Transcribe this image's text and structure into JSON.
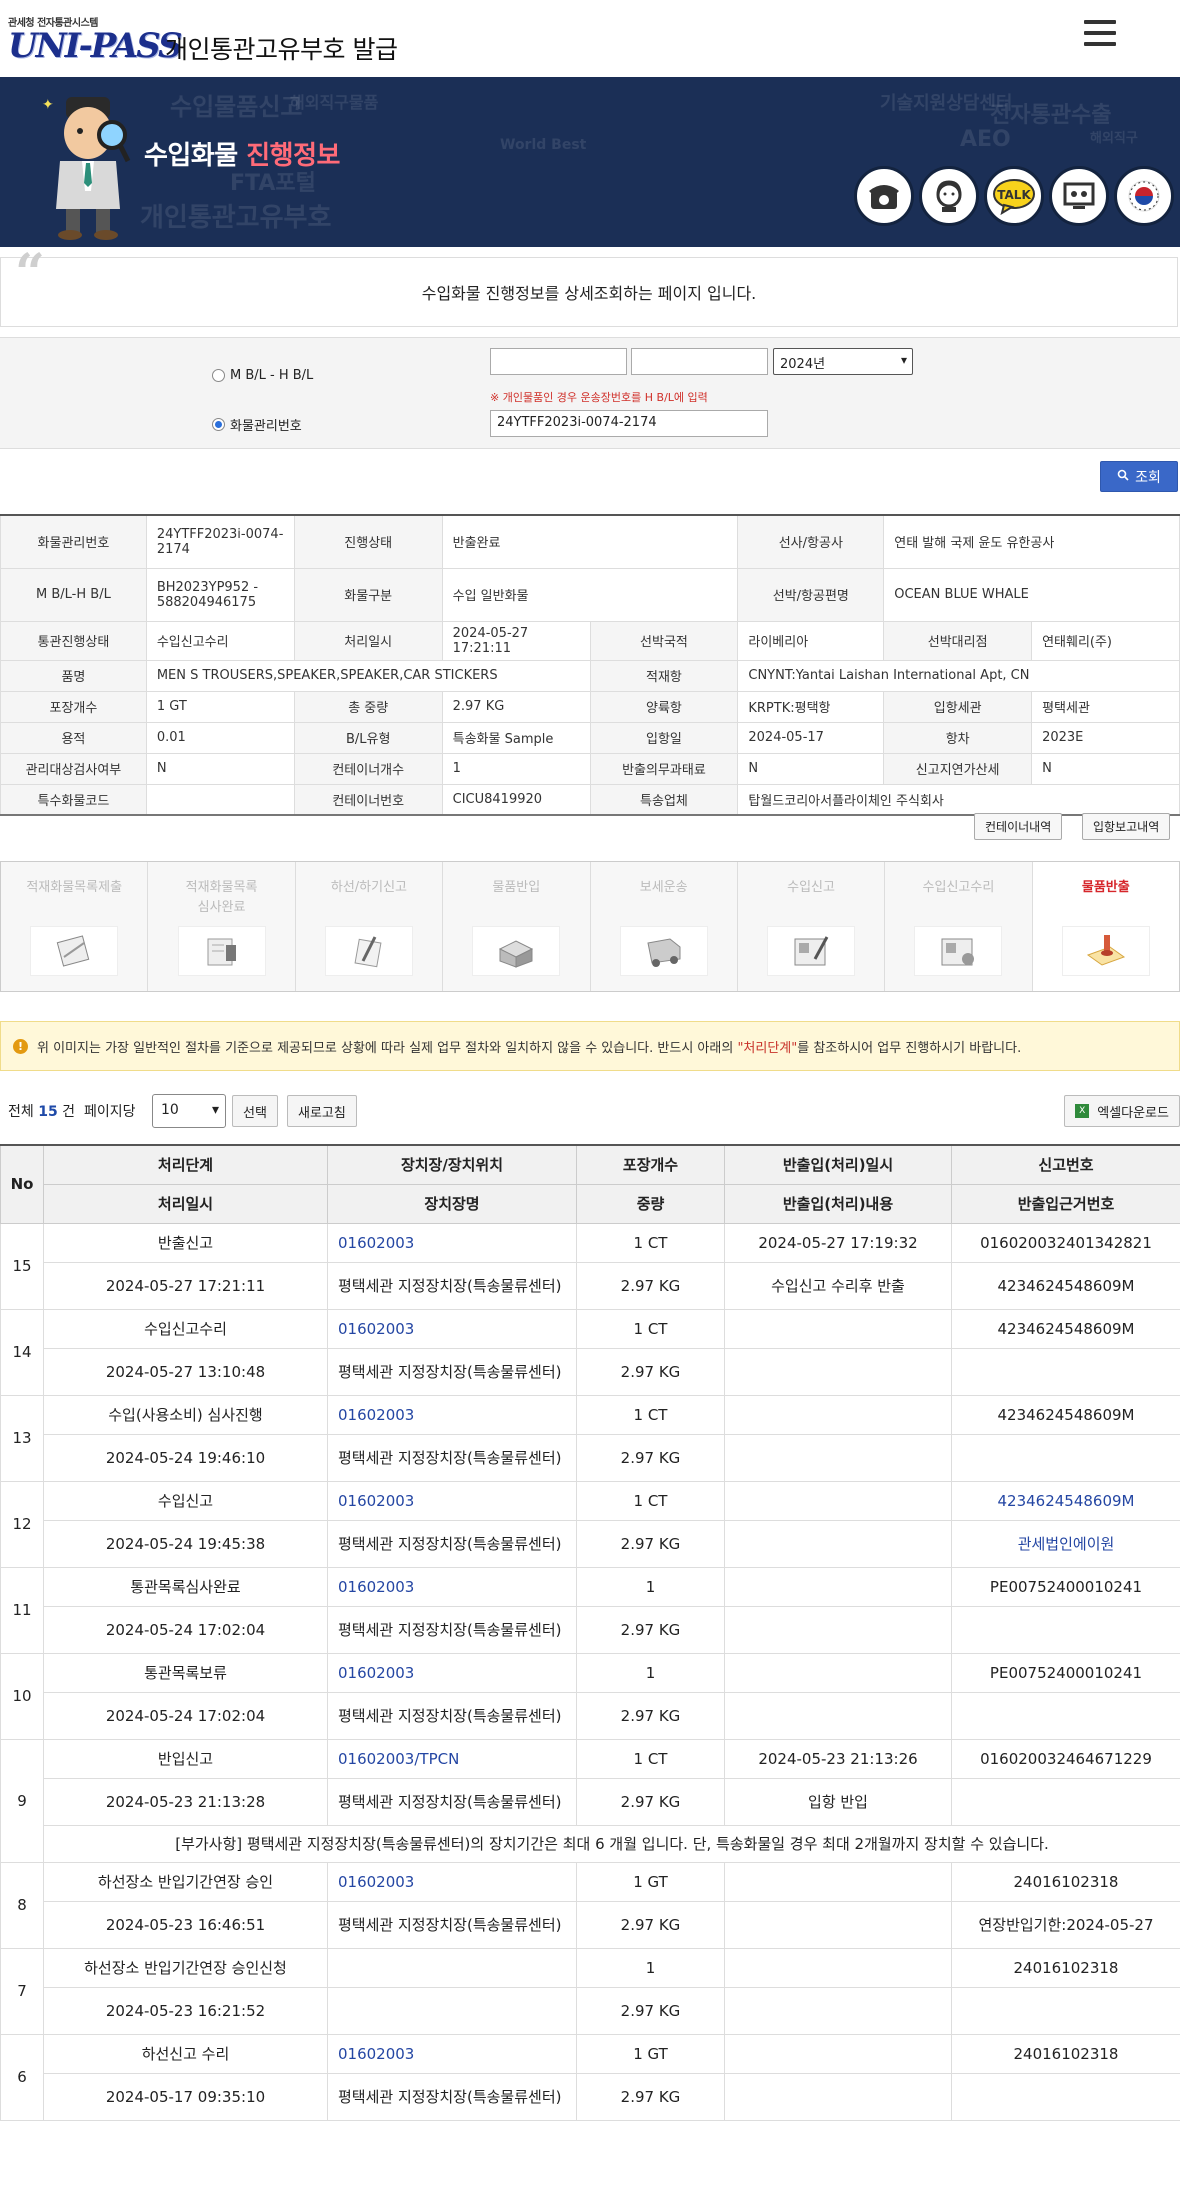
{
  "header": {
    "logo_small": "관세청 전자통관시스템",
    "logo_main": "UNI-PASS",
    "site_title": "개인통관고유부호 발급"
  },
  "banner": {
    "title_white": "수입화물",
    "title_accent": "진행정보",
    "bg_words": [
      "수입물품신고",
      "해외직구물품",
      "개인통관고유부호",
      "FTA포털",
      "World Best",
      "기술지원상담센터",
      "전자통관수출",
      "AEO",
      "해외직구"
    ]
  },
  "description": "수입화물 진행정보를 상세조회하는 페이지 입니다.",
  "search": {
    "radio_mbl": "M B/L - H B/L",
    "radio_cargo": "화물관리번호",
    "year_select": "2024년",
    "note": "※ 개인물품인 경우 운송장번호를 H B/L에 입력",
    "cargo_no": "24YTFF2023i-0074-2174",
    "query_button": "조회"
  },
  "info": {
    "rows": [
      [
        "화물관리번호",
        "24YTFF2023i-0074-2174",
        "진행상태",
        "반출완료",
        "선사/항공사",
        "연태 발해 국제 윤도 유한공사"
      ],
      [
        "M B/L-H B/L",
        "BH2023YP952 - 588204946175",
        "화물구분",
        "수입 일반화물",
        "선박/항공편명",
        "OCEAN BLUE WHALE"
      ],
      [
        "통관진행상태",
        "수입신고수리",
        "처리일시",
        "2024-05-27 17:21:11",
        "선박국적",
        "라이베리아",
        "선박대리점",
        "연태훼리(주)"
      ],
      [
        "품명",
        "MEN S TROUSERS,SPEAKER,SPEAKER,CAR STICKERS",
        "적재항",
        "CNYNT:Yantai Laishan International Apt, CN"
      ],
      [
        "포장개수",
        "1 GT",
        "총 중량",
        "2.97 KG",
        "양륙항",
        "KRPTK:평택항",
        "입항세관",
        "평택세관"
      ],
      [
        "용적",
        "0.01",
        "B/L유형",
        "특송화물 Sample",
        "입항일",
        "2024-05-17",
        "항차",
        "2023E"
      ],
      [
        "관리대상검사여부",
        "N",
        "컨테이너개수",
        "1",
        "반출의무과태료",
        "N",
        "신고지연가산세",
        "N"
      ],
      [
        "특수화물코드",
        "",
        "컨테이너번호",
        "CICU8419920",
        "특송업체",
        "탑월드코리아서플라이체인 주식회사"
      ]
    ],
    "btn_container": "컨테이너내역",
    "btn_entry_report": "입항보고내역"
  },
  "steps": [
    "적재화물목록제출",
    "적재화물목록\n심사완료",
    "하선/하기신고",
    "물품반입",
    "보세운송",
    "수입신고",
    "수입신고수리",
    "물품반출"
  ],
  "notice": {
    "text_before": "위 이미지는 가장 일반적인 절차를 기준으로 제공되므로 상황에 따라 실제 업무 절차와 일치하지 않을 수 있습니다. 반드시 아래의 ",
    "text_highlight": "\"처리단계\"",
    "text_after": "를 참조하시어 업무 진행하시기 바랍니다."
  },
  "list": {
    "total_prefix": "전체",
    "total_count": "15",
    "total_suffix": "건",
    "per_page_label": "페이지당",
    "per_page_value": "10",
    "btn_select": "선택",
    "btn_refresh": "새로고침",
    "btn_excel": "엑셀다운로드"
  },
  "history": {
    "headers_top": [
      "No",
      "처리단계",
      "장치장/장치위치",
      "포장개수",
      "반출입(처리)일시",
      "신고번호"
    ],
    "headers_bottom": [
      "처리일시",
      "장치장명",
      "중량",
      "반출입(처리)내용",
      "반출입근거번호"
    ],
    "rows": [
      {
        "no": "15",
        "stage": "반출신고",
        "loc": "01602003",
        "pkg": "1 CT",
        "io_time": "2024-05-27 17:19:32",
        "decl": "016020032401342821",
        "time": "2024-05-27 17:21:11",
        "loc_name": "평택세관 지정장치장(특송물류센터)",
        "weight": "2.97 KG",
        "io_content": "수입신고 수리후 반출",
        "basis": "4234624548609M"
      },
      {
        "no": "14",
        "stage": "수입신고수리",
        "loc": "01602003",
        "pkg": "1 CT",
        "io_time": "",
        "decl": "4234624548609M",
        "time": "2024-05-27 13:10:48",
        "loc_name": "평택세관 지정장치장(특송물류센터)",
        "weight": "2.97 KG",
        "io_content": "",
        "basis": ""
      },
      {
        "no": "13",
        "stage": "수입(사용소비) 심사진행",
        "loc": "01602003",
        "pkg": "1 CT",
        "io_time": "",
        "decl": "4234624548609M",
        "time": "2024-05-24 19:46:10",
        "loc_name": "평택세관 지정장치장(특송물류센터)",
        "weight": "2.97 KG",
        "io_content": "",
        "basis": ""
      },
      {
        "no": "12",
        "stage": "수입신고",
        "loc": "01602003",
        "pkg": "1 CT",
        "io_time": "",
        "decl": "4234624548609M",
        "time": "2024-05-24 19:45:38",
        "loc_name": "평택세관 지정장치장(특송물류센터)",
        "weight": "2.97 KG",
        "io_content": "",
        "basis": "관세법인에이원"
      },
      {
        "no": "11",
        "stage": "통관목록심사완료",
        "loc": "01602003",
        "pkg": "1",
        "io_time": "",
        "decl": "PE00752400010241",
        "time": "2024-05-24 17:02:04",
        "loc_name": "평택세관 지정장치장(특송물류센터)",
        "weight": "2.97 KG",
        "io_content": "",
        "basis": ""
      },
      {
        "no": "10",
        "stage": "통관목록보류",
        "loc": "01602003",
        "pkg": "1",
        "io_time": "",
        "decl": "PE00752400010241",
        "time": "2024-05-24 17:02:04",
        "loc_name": "평택세관 지정장치장(특송물류센터)",
        "weight": "2.97 KG",
        "io_content": "",
        "basis": ""
      },
      {
        "no": "9",
        "stage": "반입신고",
        "loc": "01602003/TPCN",
        "pkg": "1 CT",
        "io_time": "2024-05-23 21:13:26",
        "decl": "016020032464671229",
        "time": "2024-05-23 21:13:28",
        "loc_name": "평택세관 지정장치장(특송물류센터)",
        "weight": "2.97 KG",
        "io_content": "입항 반입",
        "basis": "",
        "extra": "[부가사항] 평택세관 지정장치장(특송물류센터)의 장치기간은 최대 6 개월 입니다. 단, 특송화물일 경우 최대 2개월까지 장치할 수 있습니다."
      },
      {
        "no": "8",
        "stage": "하선장소 반입기간연장 승인",
        "loc": "01602003",
        "pkg": "1 GT",
        "io_time": "",
        "decl": "24016102318",
        "time": "2024-05-23 16:46:51",
        "loc_name": "평택세관 지정장치장(특송물류센터)",
        "weight": "2.97 KG",
        "io_content": "",
        "basis": "연장반입기한:2024-05-27"
      },
      {
        "no": "7",
        "stage": "하선장소 반입기간연장 승인신청",
        "loc": "",
        "pkg": "1",
        "io_time": "",
        "decl": "24016102318",
        "time": "2024-05-23 16:21:52",
        "loc_name": "",
        "weight": "2.97 KG",
        "io_content": "",
        "basis": ""
      },
      {
        "no": "6",
        "stage": "하선신고 수리",
        "loc": "01602003",
        "pkg": "1 GT",
        "io_time": "",
        "decl": "24016102318",
        "time": "2024-05-17 09:35:10",
        "loc_name": "평택세관 지정장치장(특송물류센터)",
        "weight": "2.97 KG",
        "io_content": "",
        "basis": ""
      }
    ]
  },
  "colors": {
    "banner_bg": "#1b2f56",
    "accent_red": "#ff6b78",
    "link_blue": "#2446a3",
    "query_button": "#3a68c8"
  }
}
